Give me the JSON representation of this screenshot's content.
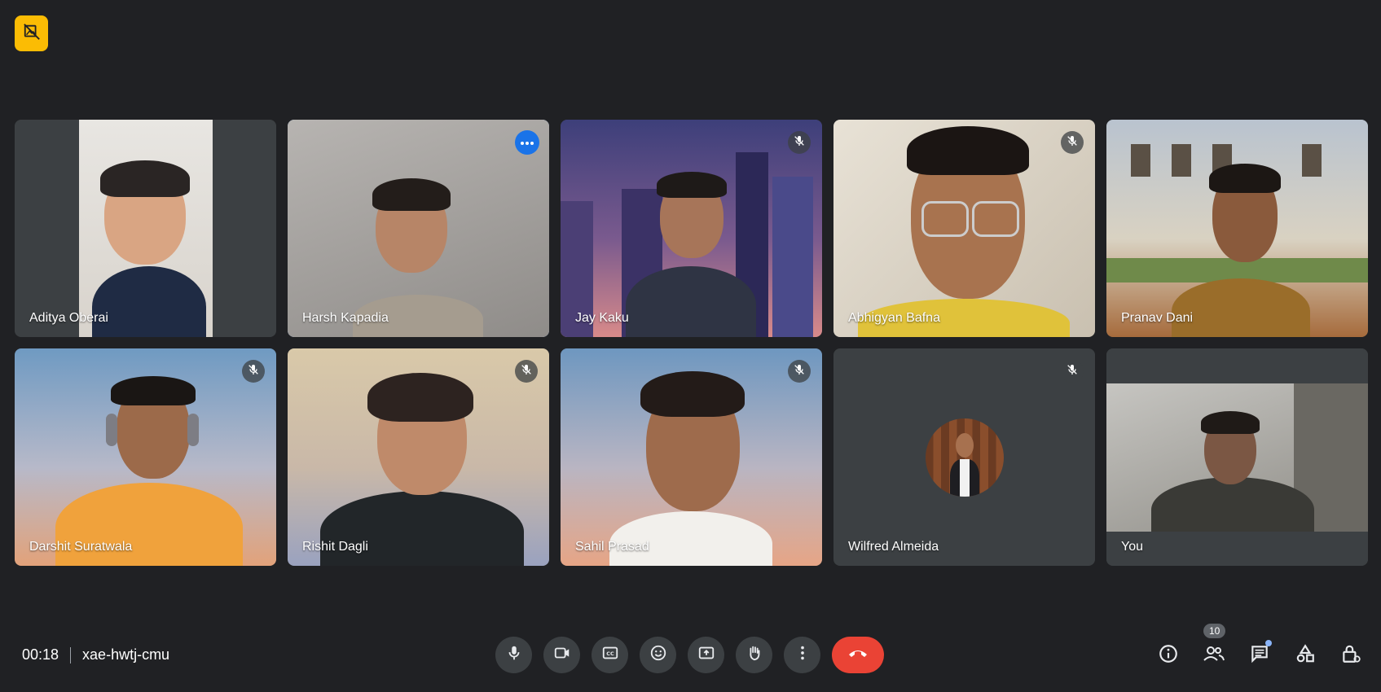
{
  "meeting": {
    "time": "00:18",
    "code": "xae-hwtj-cmu"
  },
  "participants": [
    {
      "name": "Aditya Oberai",
      "muted": false
    },
    {
      "name": "Harsh Kapadia",
      "muted": false,
      "active": true
    },
    {
      "name": "Jay Kaku",
      "muted": true
    },
    {
      "name": "Abhigyan Bafna",
      "muted": true
    },
    {
      "name": "Pranav Dani",
      "muted": false
    },
    {
      "name": "Darshit Suratwala",
      "muted": true
    },
    {
      "name": "Rishit Dagli",
      "muted": true
    },
    {
      "name": "Sahil Prasad",
      "muted": true
    },
    {
      "name": "Wilfred Almeida",
      "muted": true
    },
    {
      "name": "You",
      "muted": false
    }
  ],
  "people_count": "10",
  "colors": {
    "background": "#202124",
    "tile": "#3c4043",
    "end_call": "#ea4335",
    "active_border": "#8ab4f8",
    "recording": "#fbbc04"
  },
  "controls": [
    "mic-icon",
    "camera-icon",
    "captions-icon",
    "emoji-icon",
    "present-icon",
    "raise-hand-icon",
    "more-options-icon",
    "end-call-icon"
  ],
  "side_controls": [
    "info-icon",
    "people-icon",
    "chat-icon",
    "activities-icon",
    "host-controls-icon"
  ]
}
